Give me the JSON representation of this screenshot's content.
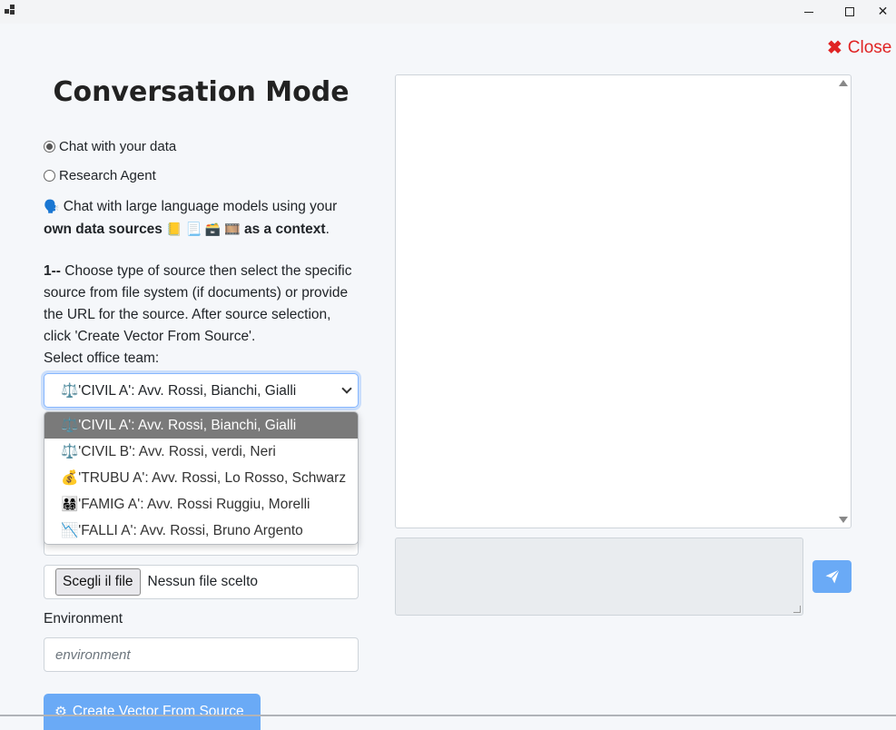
{
  "window": {
    "minimize_glyph": "minimize",
    "maximize_glyph": "maximize",
    "close_glyph": "✕"
  },
  "close_link": {
    "icon": "✖",
    "label": "Close",
    "color": "#e02424"
  },
  "page_title": "Conversation Mode",
  "modes": [
    {
      "label": "Chat with your data",
      "checked": true
    },
    {
      "label": "Research Agent",
      "checked": false
    }
  ],
  "intro": {
    "icon": "🗣️",
    "text_part1": "Chat with large language models using your ",
    "bold_part1": "own data sources",
    "icons": "📒 📃 🗃️ 🎞️",
    "bold_part2": "as a context",
    "end": "."
  },
  "instructions": {
    "step": "1--",
    "text": " Choose type of source then select the specific source from file system (if documents) or provide the URL for the source. After source selection, click 'Create Vector From Source'."
  },
  "team_select": {
    "label": "Select office team:",
    "selected": "⚖️'CIVIL A': Avv. Rossi, Bianchi, Gialli",
    "options": [
      "⚖️'CIVIL A': Avv. Rossi, Bianchi, Gialli",
      "⚖️'CIVIL B': Avv. Rossi, verdi, Neri",
      "💰'TRUBU A': Avv. Rossi, Lo Rosso, Schwarz",
      "👨‍👩‍👧‍👦'FAMIG A': Avv. Rossi Ruggiu, Morelli",
      "📉'FALLI A': Avv. Rossi, Bruno Argento"
    ]
  },
  "file_input": {
    "button": "Scegli il file",
    "status": "Nessun file scelto"
  },
  "environment": {
    "label": "Environment",
    "placeholder": "environment"
  },
  "create_button": {
    "icon": "⚙",
    "label": "Create Vector From Source"
  },
  "accent_color": "#6aaaf6"
}
